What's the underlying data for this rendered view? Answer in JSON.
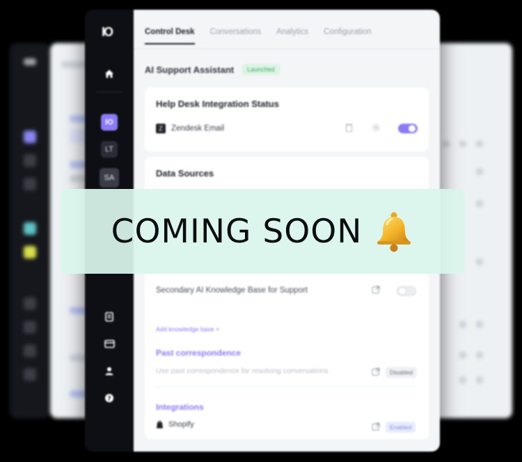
{
  "brand": {
    "logo_text": "IO"
  },
  "sidebar": {
    "items": [
      {
        "icon": "home-icon",
        "label": ""
      },
      {
        "icon": "io-icon",
        "label": "IO",
        "active": true
      },
      {
        "icon": "initials-icon",
        "label": "LT"
      },
      {
        "icon": "initials-icon",
        "label": "SA"
      },
      {
        "icon": "document-icon",
        "label": ""
      },
      {
        "icon": "card-icon",
        "label": ""
      },
      {
        "icon": "user-icon",
        "label": ""
      },
      {
        "icon": "help-icon",
        "label": ""
      }
    ]
  },
  "tabs": [
    {
      "label": "Control Desk",
      "active": true
    },
    {
      "label": "Conversations"
    },
    {
      "label": "Analytics"
    },
    {
      "label": "Configuration"
    }
  ],
  "assistant": {
    "title": "AI Support Assistant",
    "status": "Launched"
  },
  "helpdesk": {
    "title": "Help Desk Integration Status",
    "integration_label": "Zendesk Email",
    "integration_icon": "Z",
    "enabled": true
  },
  "data_sources": {
    "title": "Data Sources",
    "secondary_kb": {
      "label": "Secondary AI Knowledge Base for Support",
      "enabled": false
    },
    "add_kb_link": "Add knowledge base +",
    "past_correspondence": {
      "title": "Past correspondence",
      "description": "Use past correspondence for resolving conversations",
      "status": "Disabled"
    },
    "integrations": {
      "title": "Integrations",
      "item_label": "Shopify",
      "item_status": "Enabled"
    }
  },
  "overlay": {
    "text": "COMING SOON",
    "icon": "bell-icon"
  },
  "colors": {
    "accent": "#8b7cf6",
    "success": "#3ca86a",
    "banner_bg": "#daf5ec",
    "sidebar_bg": "#0d0f14"
  }
}
